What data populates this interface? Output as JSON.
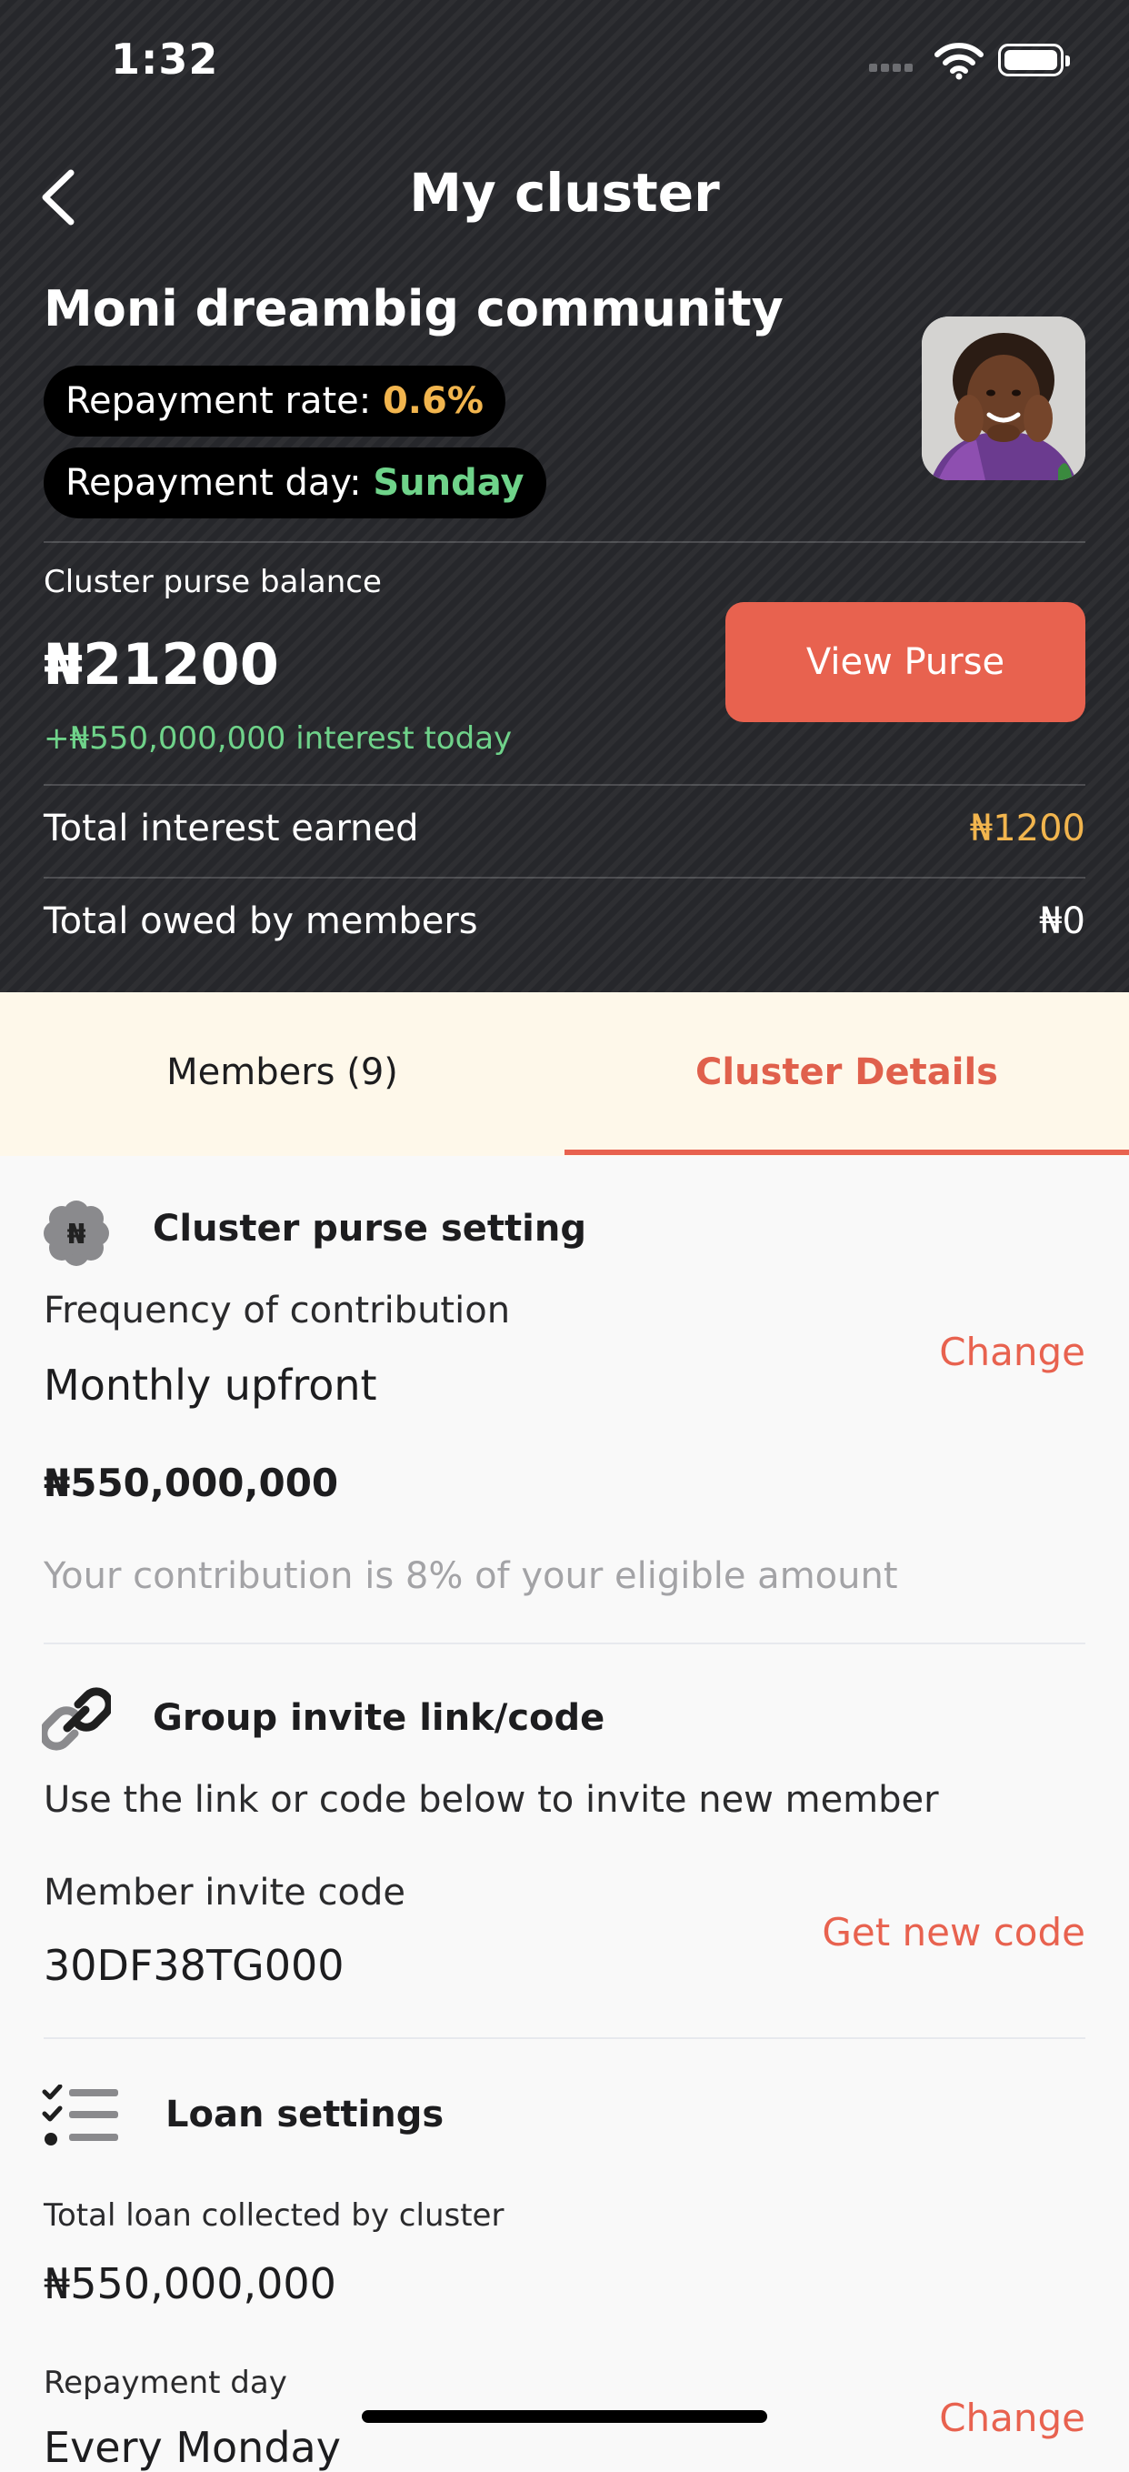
{
  "status_bar": {
    "time": "1:32"
  },
  "header": {
    "title": "My cluster",
    "cluster_name": "Moni dreambig community",
    "repayment_rate_label": "Repayment rate: ",
    "repayment_rate_value": "0.6%",
    "repayment_day_label": "Repayment day: ",
    "repayment_day_value": "Sunday",
    "purse_balance_label": "Cluster purse balance",
    "purse_balance": "₦21200",
    "interest_today": "+₦550,000,000 interest today",
    "view_purse_label": "View Purse",
    "total_interest_label": "Total interest earned",
    "total_interest_value": "₦1200",
    "total_owed_label": "Total owed by members",
    "total_owed_value": "₦0"
  },
  "tabs": [
    {
      "label": "Members (9)",
      "active": false
    },
    {
      "label": "Cluster Details",
      "active": true
    }
  ],
  "purse_setting": {
    "title": "Cluster purse setting",
    "icon_glyph": "₦",
    "frequency_label": "Frequency of contribution",
    "frequency_value": "Monthly upfront",
    "change_label": "Change",
    "amount": "₦550,000,000",
    "note": "Your contribution is 8% of your eligible amount"
  },
  "invite": {
    "title": "Group invite link/code",
    "description": "Use the link or code below to invite new member",
    "code_label": "Member invite code",
    "code_value": "30DF38TG000",
    "new_code_label": "Get new code"
  },
  "loan_settings": {
    "title": "Loan settings",
    "total_loan_label": "Total loan collected by cluster",
    "total_loan_value": "₦550,000,000",
    "repayment_day_label": "Repayment day",
    "repayment_day_value": "Every Monday",
    "change_label": "Change"
  },
  "colors": {
    "accent": "#e8624f",
    "header_bg": "#26272b",
    "rate_yellow": "#f2b54e",
    "positive_green": "#6fd38a",
    "tab_bg": "#fef8ea"
  }
}
